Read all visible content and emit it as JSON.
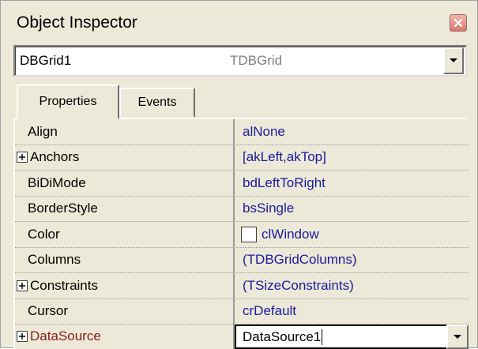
{
  "window": {
    "title": "Object Inspector",
    "close_icon": "close-icon"
  },
  "component_selector": {
    "name": "DBGrid1",
    "type": "TDBGrid"
  },
  "tabs": [
    {
      "label": "Properties",
      "active": true
    },
    {
      "label": "Events",
      "active": false
    }
  ],
  "properties": [
    {
      "name": "Align",
      "value": "alNone",
      "expandable": false
    },
    {
      "name": "Anchors",
      "value": "[akLeft,akTop]",
      "expandable": true
    },
    {
      "name": "BiDiMode",
      "value": "bdLeftToRight",
      "expandable": false
    },
    {
      "name": "BorderStyle",
      "value": "bsSingle",
      "expandable": false
    },
    {
      "name": "Color",
      "value": "clWindow",
      "expandable": false,
      "swatch": "#ffffff"
    },
    {
      "name": "Columns",
      "value": "(TDBGridColumns)",
      "expandable": false
    },
    {
      "name": "Constraints",
      "value": "(TSizeConstraints)",
      "expandable": true
    },
    {
      "name": "Cursor",
      "value": "crDefault",
      "expandable": false
    },
    {
      "name": "DataSource",
      "value": "DataSource1",
      "expandable": true,
      "selected": true
    }
  ],
  "colors": {
    "value_text": "#1a1a9c",
    "selected_name": "#8b1a1a",
    "background": "#ece9d8"
  }
}
